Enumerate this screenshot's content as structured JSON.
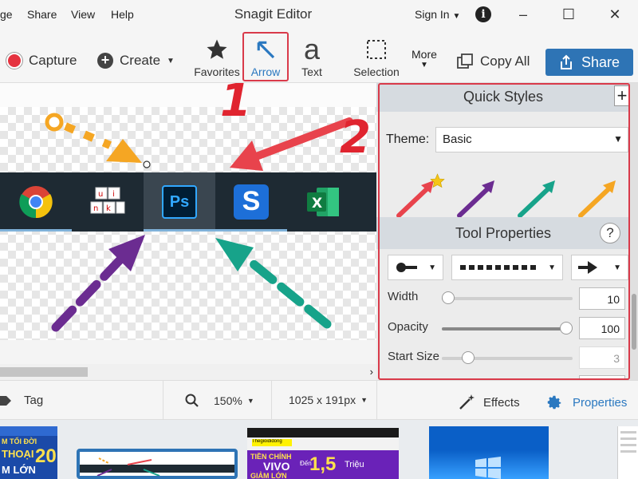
{
  "menu": {
    "items": [
      "ge",
      "Share",
      "View",
      "Help"
    ],
    "title": "Snagit Editor",
    "sign_in": "Sign In",
    "info_icon": "info-icon"
  },
  "toolbar": {
    "capture_label": "Capture",
    "create_label": "Create",
    "tools": [
      {
        "label": "Favorites",
        "icon": "star-icon"
      },
      {
        "label": "Arrow",
        "icon": "arrow-icon",
        "active": true
      },
      {
        "label": "Text",
        "icon": "text-a-icon"
      },
      {
        "label": "Selection",
        "icon": "selection-icon"
      }
    ],
    "more_label": "More",
    "copy_all_label": "Copy All",
    "share_label": "Share"
  },
  "callouts": {
    "one": "1",
    "two": "2"
  },
  "canvas": {
    "taskbar_apps": [
      "chrome",
      "unikey",
      "Ps",
      "snagit",
      "excel"
    ],
    "colors": {
      "orange": "#f5a623",
      "red": "#e8434c",
      "purple": "#6b2c91",
      "teal": "#17a38a"
    }
  },
  "panel": {
    "quick_styles_title": "Quick Styles",
    "theme_label": "Theme:",
    "theme_value": "Basic",
    "tool_properties_title": "Tool Properties",
    "help_label": "?",
    "properties": [
      {
        "label": "Width",
        "value": "10",
        "level": 0.05,
        "disabled": false
      },
      {
        "label": "Opacity",
        "value": "100",
        "level": 1.0,
        "disabled": false
      },
      {
        "label": "Start Size",
        "value": "3",
        "level": 0.2,
        "disabled": true
      }
    ]
  },
  "bottombar": {
    "tag_label": "Tag",
    "zoom_value": "150%",
    "size_value": "1025 x 191px",
    "effects_label": "Effects",
    "properties_label": "Properties"
  },
  "tray": {
    "thumb1_text": [
      "M TỐI ĐỜI",
      "THOẠI",
      "M LỚN",
      "20"
    ],
    "thumb3_text": [
      "Thegioididong",
      "TIỀN CHÍNH",
      "VIVO",
      "GIẢM LỚN",
      "1,5",
      "Triệu",
      "Đến"
    ]
  }
}
